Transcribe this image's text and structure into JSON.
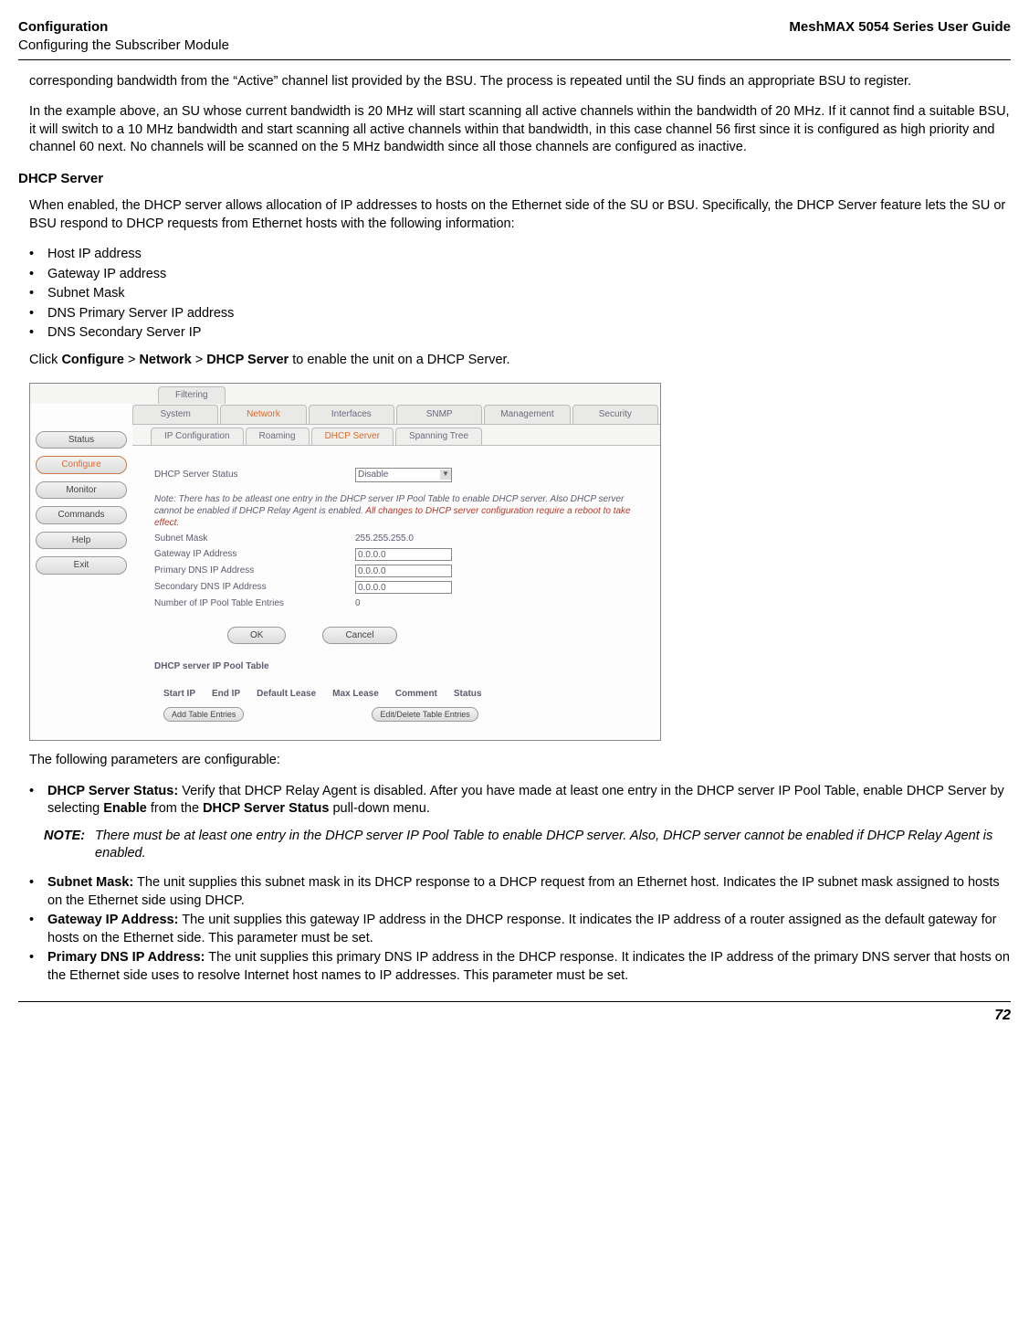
{
  "header": {
    "left_title": "Configuration",
    "left_sub": "Configuring the Subscriber Module",
    "right": "MeshMAX 5054 Series User Guide"
  },
  "para1": "corresponding bandwidth from the “Active” channel list provided by the BSU. The process is repeated until the SU finds an appropriate BSU to register.",
  "para2": "In the example above, an SU whose current bandwidth is 20 MHz will start scanning all active channels within the bandwidth of 20 MHz. If it cannot find a suitable BSU, it will switch to a 10 MHz bandwidth and start scanning all active channels within that bandwidth, in this case channel 56 first since it is configured as high priority and channel 60 next. No channels will be scanned on the 5 MHz bandwidth since all those channels are configured as inactive.",
  "section_dhcp": "DHCP Server",
  "para3": "When enabled, the DHCP server allows allocation of IP addresses to hosts on the Ethernet side of the SU or BSU. Specifically, the DHCP Server feature lets the SU or BSU respond to DHCP requests from Ethernet hosts with the following information:",
  "bullets1": [
    "Host IP address",
    "Gateway IP address",
    "Subnet Mask",
    "DNS Primary Server IP address",
    "DNS Secondary Server IP"
  ],
  "click_line": {
    "pre": "Click ",
    "b1": "Configure",
    "sep": " > ",
    "b2": "Network",
    "b3": "DHCP Server",
    "post": " to enable the unit on a DHCP Server."
  },
  "screenshot": {
    "top_tab": "Filtering",
    "nav": [
      "Status",
      "Configure",
      "Monitor",
      "Commands",
      "Help",
      "Exit"
    ],
    "maintabs": [
      "System",
      "Network",
      "Interfaces",
      "SNMP",
      "Management",
      "Security"
    ],
    "subtabs": [
      "IP Configuration",
      "Roaming",
      "DHCP Server",
      "Spanning Tree"
    ],
    "status_label": "DHCP Server Status",
    "status_value": "Disable",
    "note1": "Note: There has to be atleast one entry in the DHCP server IP Pool Table to enable DHCP server. Also DHCP server cannot be enabled if DHCP Relay Agent is enabled.",
    "note2": "All changes to DHCP server configuration require a reboot to take effect.",
    "rows": [
      {
        "label": "Subnet Mask",
        "value": "255.255.255.0",
        "type": "static"
      },
      {
        "label": "Gateway IP Address",
        "value": "0.0.0.0",
        "type": "input"
      },
      {
        "label": "Primary DNS IP Address",
        "value": "0.0.0.0",
        "type": "input"
      },
      {
        "label": "Secondary DNS IP Address",
        "value": "0.0.0.0",
        "type": "input"
      },
      {
        "label": "Number of IP Pool Table Entries",
        "value": "0",
        "type": "static"
      }
    ],
    "ok": "OK",
    "cancel": "Cancel",
    "pool_title": "DHCP server IP Pool Table",
    "pool_cols": [
      "Start IP",
      "End IP",
      "Default Lease",
      "Max Lease",
      "Comment",
      "Status"
    ],
    "add_btn": "Add Table Entries",
    "edit_btn": "Edit/Delete Table Entries"
  },
  "para4": "The following parameters are configurable:",
  "items": {
    "i1_b": "DHCP Server Status:",
    "i1_t1": " Verify that DHCP Relay Agent is disabled. After you have made at least one entry in the DHCP server IP Pool Table, enable DHCP Server by selecting ",
    "i1_b2": "Enable",
    "i1_t2": " from the ",
    "i1_b3": "DHCP Server Status",
    "i1_t3": " pull-down menu.",
    "note_label": "NOTE:",
    "note_text": "There must be at least one entry in the DHCP server IP Pool Table to enable DHCP server. Also, DHCP server cannot be enabled if DHCP Relay Agent is enabled.",
    "i2_b": "Subnet Mask:",
    "i2_t": " The unit supplies this subnet mask in its DHCP response to a DHCP request from an Ethernet host. Indicates the IP subnet mask assigned to hosts on the Ethernet side using DHCP.",
    "i3_b": "Gateway IP Address:",
    "i3_t": " The unit supplies this gateway IP address in the DHCP response. It indicates the IP address of a router assigned as the default gateway for hosts on the Ethernet side. This parameter must be set.",
    "i4_b": "Primary DNS IP Address:",
    "i4_t": " The unit supplies this primary DNS IP address in the DHCP response. It indicates the IP address of the primary DNS server that hosts on the Ethernet side uses to resolve Internet host names to IP addresses. This parameter must be set."
  },
  "page_number": "72"
}
